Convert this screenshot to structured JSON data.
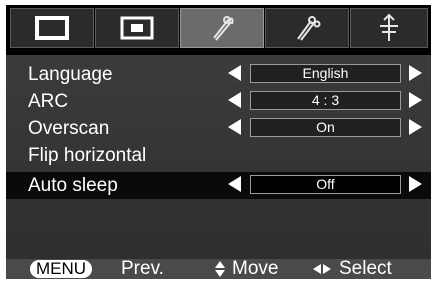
{
  "tabs": [
    {
      "name": "picture",
      "icon": "screen-icon",
      "active": false
    },
    {
      "name": "screen",
      "icon": "screen-inset-icon",
      "active": false
    },
    {
      "name": "setup",
      "icon": "setup-icon",
      "active": true
    },
    {
      "name": "options",
      "icon": "options-icon",
      "active": false
    },
    {
      "name": "info",
      "icon": "info-icon",
      "active": false
    }
  ],
  "menu": {
    "items": [
      {
        "label": "Language",
        "value": "English"
      },
      {
        "label": "ARC",
        "value": "4 : 3"
      },
      {
        "label": "Overscan",
        "value": "On"
      },
      {
        "label": "Flip horizontal",
        "value": ""
      },
      {
        "label": "Auto sleep",
        "value": "Off"
      }
    ],
    "selected_index": 4
  },
  "footer": {
    "menu_key": "MENU",
    "prev": "Prev.",
    "move_icon": "updown-icon",
    "move": "Move",
    "select_icon": "leftright-icon",
    "select": "Select"
  }
}
